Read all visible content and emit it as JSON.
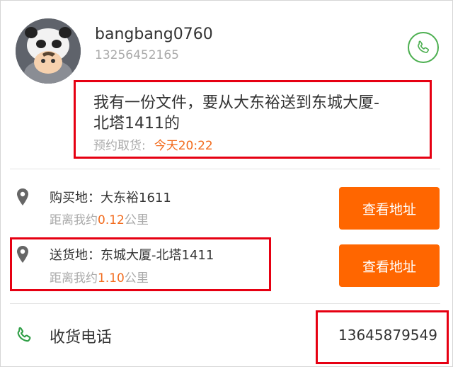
{
  "user": {
    "name": "bangbang0760",
    "phone": "13256452165"
  },
  "request": {
    "line1": "我有一份文件，要从大东裕送到东城大厦-",
    "line2": "北塔1411的",
    "pickup_label": "预约取货:",
    "pickup_time": "今天20:22"
  },
  "purchase": {
    "title": "购买地：大东裕1611",
    "dist_prefix": "距离我约",
    "dist_value": "0.12",
    "dist_unit": "公里",
    "button": "查看地址"
  },
  "delivery": {
    "title": "送货地：东城大厦-北塔1411",
    "dist_prefix": "距离我约",
    "dist_value": "1.10",
    "dist_unit": "公里",
    "button": "查看地址"
  },
  "receiver": {
    "label": "收货电话",
    "phone": "13645879549"
  },
  "icons": {
    "avatar": "avatar-image",
    "call": "phone-icon",
    "pin": "location-pin-icon",
    "receiver_phone": "phone-icon"
  },
  "colors": {
    "accent_orange": "#ff6600",
    "highlight_orange": "#f26b1d",
    "call_green": "#4caf50",
    "annotation_red": "#e60012"
  }
}
